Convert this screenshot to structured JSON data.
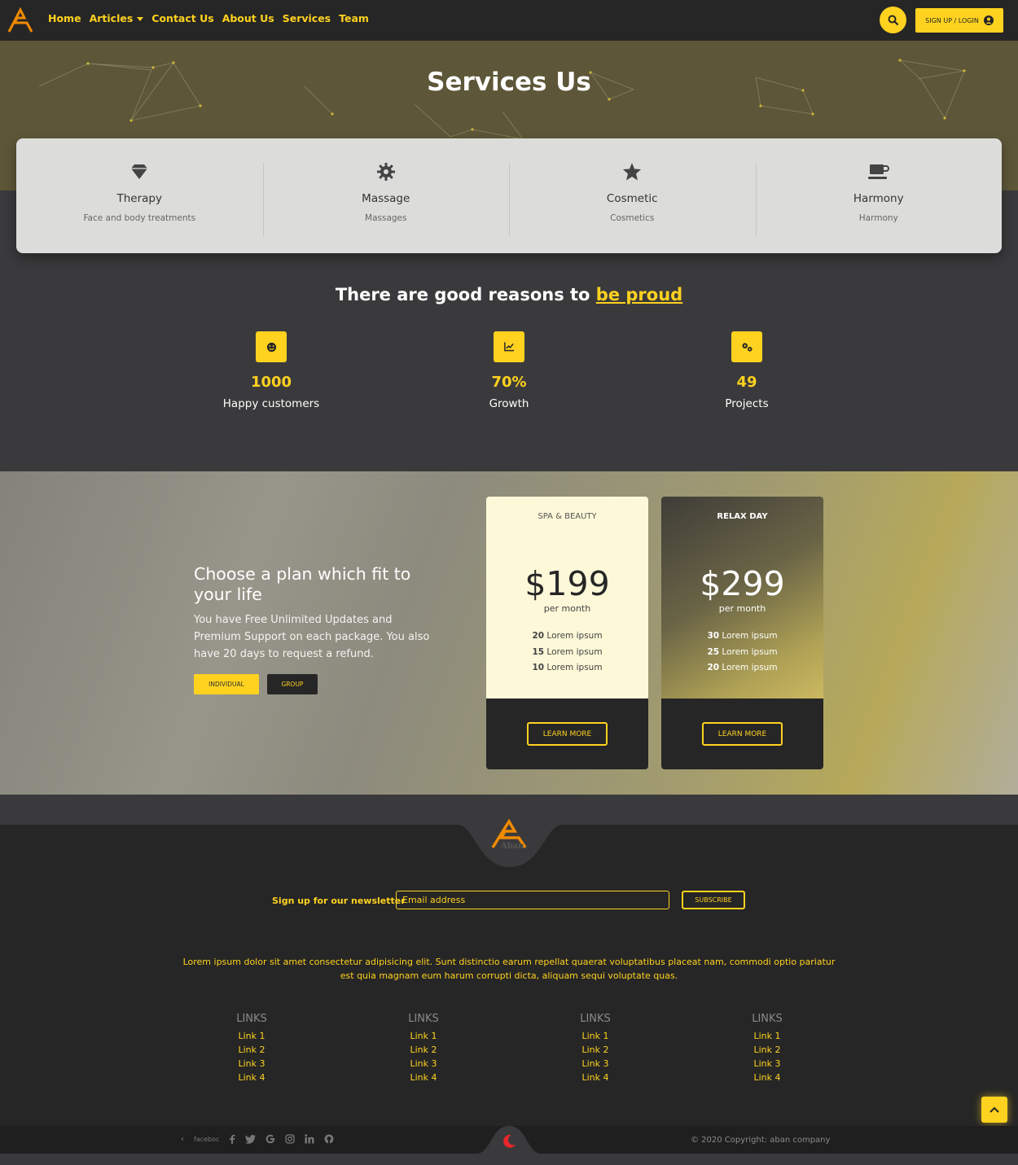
{
  "nav": {
    "logo_icon": "aban-logo",
    "items": [
      "Home",
      "Articles",
      "Contact Us",
      "About Us",
      "Services",
      "Team"
    ],
    "search_icon": "search-icon",
    "signup_label": "SIGN UP / LOGIN",
    "signup_icon": "user-circle-icon"
  },
  "hero": {
    "title": "Services Us"
  },
  "services": [
    {
      "icon": "gem-icon",
      "title": "Therapy",
      "subtitle": "Face and body treatments"
    },
    {
      "icon": "cog-icon",
      "title": "Massage",
      "subtitle": "Massages"
    },
    {
      "icon": "star-icon",
      "title": "Cosmetic",
      "subtitle": "Cosmetics"
    },
    {
      "icon": "coffee-icon",
      "title": "Harmony",
      "subtitle": "Harmony"
    }
  ],
  "reasons": {
    "prefix": "There are good reasons to",
    "highlight": "be proud"
  },
  "stats": [
    {
      "icon": "smile-icon",
      "value": "1000",
      "label": "Happy customers"
    },
    {
      "icon": "chart-line-icon",
      "value": "70%",
      "label": "Growth"
    },
    {
      "icon": "cogs-icon",
      "value": "49",
      "label": "Projects"
    }
  ],
  "plans": {
    "heading": "Choose a plan which fit to your life",
    "text": "You have Free Unlimited Updates and Premium Support on each package. You also have 20 days to request a refund.",
    "btn_individual": "INDIVIDUAL",
    "btn_group": "GROUP",
    "cards": [
      {
        "name": "SPA & BEAUTY",
        "price": "$199",
        "period": "per month",
        "features": [
          {
            "n": "20",
            "t": "Lorem ipsum"
          },
          {
            "n": "15",
            "t": "Lorem ipsum"
          },
          {
            "n": "10",
            "t": "Lorem ipsum"
          }
        ],
        "cta": "LEARN MORE"
      },
      {
        "name": "RELAX DAY",
        "price": "$299",
        "period": "per month",
        "features": [
          {
            "n": "30",
            "t": "Lorem ipsum"
          },
          {
            "n": "25",
            "t": "Lorem ipsum"
          },
          {
            "n": "20",
            "t": "Lorem ipsum"
          }
        ],
        "cta": "LEARN MORE"
      }
    ]
  },
  "footer": {
    "logo_text": "Aban",
    "newsletter_label": "Sign up for our newsletter",
    "email_placeholder": "Email address",
    "subscribe": "SUBSCRIBE",
    "lorem": "Lorem ipsum dolor sit amet consectetur adipisicing elit. Sunt distinctio earum repellat quaerat voluptatibus placeat nam, commodi optio pariatur est quia magnam eum harum corrupti dicta, aliquam sequi voluptate quas.",
    "link_columns": [
      {
        "heading": "LINKS",
        "links": [
          "Link 1",
          "Link 2",
          "Link 3",
          "Link 4"
        ]
      },
      {
        "heading": "LINKS",
        "links": [
          "Link 1",
          "Link 2",
          "Link 3",
          "Link 4"
        ]
      },
      {
        "heading": "LINKS",
        "links": [
          "Link 1",
          "Link 2",
          "Link 3",
          "Link 4"
        ]
      },
      {
        "heading": "LINKS",
        "links": [
          "Link 1",
          "Link 2",
          "Link 3",
          "Link 4"
        ]
      }
    ],
    "social_prefix": "faceboc",
    "social_icons": [
      "facebook-icon",
      "twitter-icon",
      "google-icon",
      "instagram-icon",
      "linkedin-icon",
      "github-icon"
    ],
    "copyright": "© 2020 Copyright: aban company",
    "theme_icon": "moon-icon",
    "scroll_top_icon": "chevron-up-icon"
  },
  "colors": {
    "accent": "#ffd21f",
    "dark": "#262626",
    "mid": "#3a3a3c",
    "hero": "#5d5638",
    "logo": "#f08a00"
  }
}
